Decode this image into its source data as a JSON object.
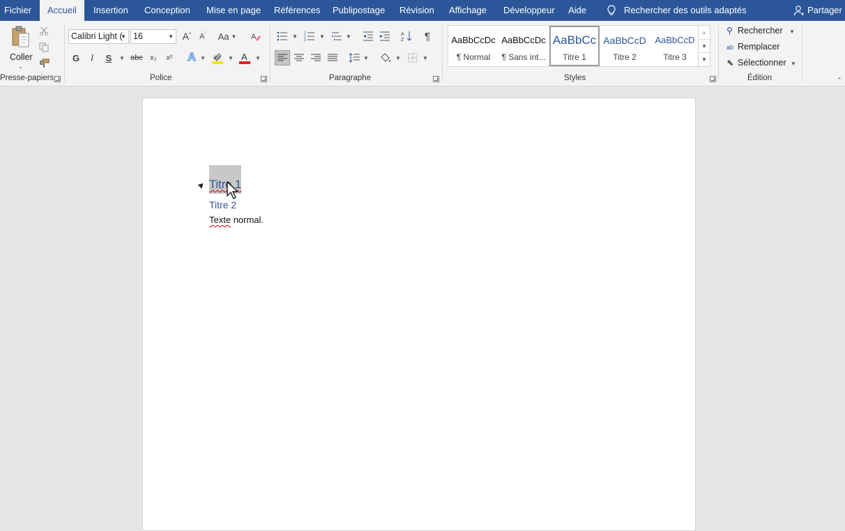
{
  "tabs": {
    "fichier": "Fichier",
    "accueil": "Accueil",
    "insertion": "Insertion",
    "conception": "Conception",
    "mise_en_page": "Mise en page",
    "references": "Références",
    "publipostage": "Publipostage",
    "revision": "Révision",
    "affichage": "Affichage",
    "developpeur": "Développeur",
    "aide": "Aide"
  },
  "tell_me": "Rechercher des outils adaptés",
  "share": "Partager",
  "clipboard": {
    "paste": "Coller",
    "group_label": "Presse-papiers"
  },
  "font": {
    "family": "Calibri Light (",
    "size": "16",
    "group_label": "Police",
    "bold": "G",
    "italic": "I",
    "underline": "S",
    "strike": "abc",
    "subscript": "x₂",
    "superscript": "x²",
    "case": "Aa"
  },
  "paragraph": {
    "group_label": "Paragraphe"
  },
  "styles": {
    "group_label": "Styles",
    "items": [
      {
        "preview": "AaBbCcDc",
        "name": "¶ Normal"
      },
      {
        "preview": "AaBbCcDc",
        "name": "¶ Sans int..."
      },
      {
        "preview": "AaBbCc",
        "name": "Titre 1"
      },
      {
        "preview": "AaBbCcD",
        "name": "Titre 2"
      },
      {
        "preview": "AaBbCcD",
        "name": "Titre 3"
      }
    ],
    "selected": "Titre 1"
  },
  "editing": {
    "group_label": "Édition",
    "find": "Rechercher",
    "replace": "Remplacer",
    "select": "Sélectionner"
  },
  "document": {
    "heading1": "Titre 1",
    "heading2": "Titre 2",
    "paragraph_word1": "Texte",
    "paragraph_rest": " normal."
  },
  "colors": {
    "brand": "#2b579a",
    "heading": "#2e5597",
    "highlight": "#f5e11b",
    "font_color": "#e0201f"
  }
}
